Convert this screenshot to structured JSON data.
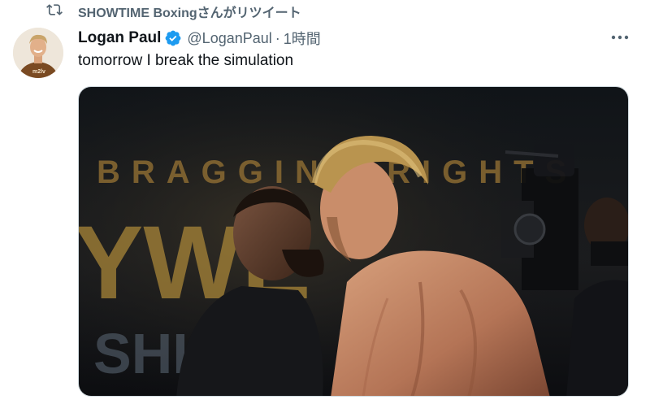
{
  "retweet": {
    "icon": "retweet-icon",
    "text": "SHOWTIME Boxingさんがリツイート"
  },
  "author": {
    "display_name": "Logan Paul",
    "verified": true,
    "verified_icon": "verified-badge-icon",
    "handle": "@LoganPaul",
    "separator": "·",
    "time": "1時間",
    "avatar_icon": "avatar-photo",
    "avatar_shirt_text": "m2lv"
  },
  "tweet": {
    "text": "tomorrow I break the simulation"
  },
  "media": {
    "backdrop_text_top": "BRAGGING RIGHTS",
    "backdrop_text_mid": "YWE",
    "backdrop_text_bottom": "SHI",
    "accessible_label": "Photo"
  },
  "colors": {
    "text_primary": "#0f1419",
    "text_secondary": "#536471",
    "verified_blue": "#1d9bf0",
    "border": "#cfd9de"
  }
}
